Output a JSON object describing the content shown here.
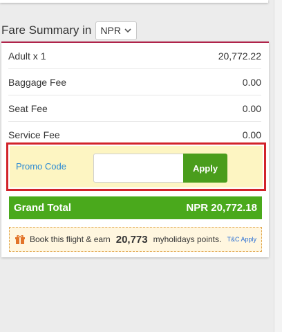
{
  "fare_summary": {
    "title": "Fare Summary in",
    "currency": "NPR",
    "rows": [
      {
        "label": "Adult x 1",
        "value": "20,772.22"
      },
      {
        "label": "Baggage Fee",
        "value": "0.00"
      },
      {
        "label": "Seat Fee",
        "value": "0.00"
      },
      {
        "label": "Service Fee",
        "value": "0.00"
      }
    ],
    "promo": {
      "label": "Promo Code",
      "input_value": "",
      "apply_label": "Apply"
    },
    "grand_total": {
      "label": "Grand Total",
      "value": "NPR 20,772.18"
    },
    "points": {
      "prefix": "Book this flight & earn",
      "number": "20,773",
      "suffix": "myholidays points.",
      "tc_label": "T&C Apply"
    }
  },
  "colors": {
    "accent_border": "#b0234a",
    "highlight_border": "#d2232a",
    "promo_bg": "#fdf5c2",
    "apply_green": "#4a9d1c",
    "total_green": "#4aa91c",
    "link_blue": "#2a8ad4",
    "points_bg": "#fff6df"
  },
  "icons": {
    "currency_dropdown": "chevron-down-icon",
    "points_badge": "gift-icon"
  }
}
